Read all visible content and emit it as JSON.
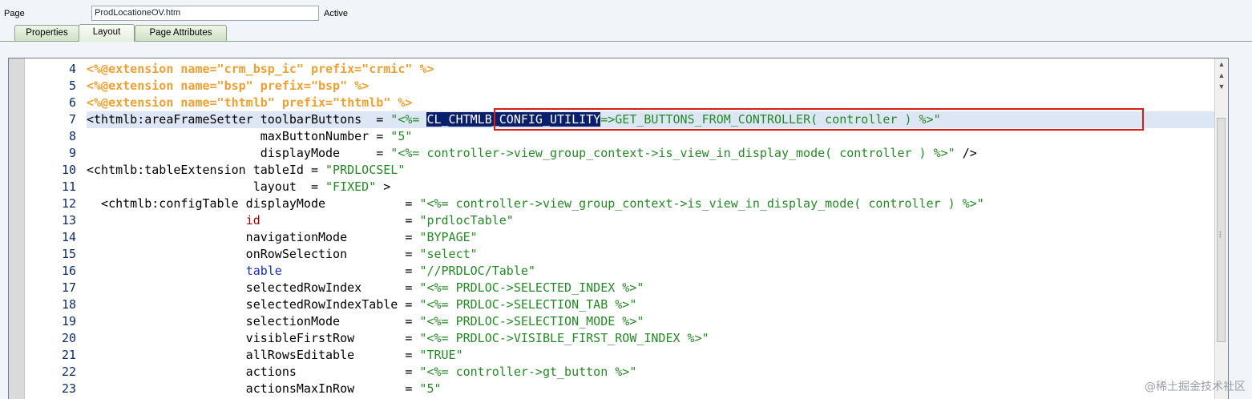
{
  "header": {
    "page_label": "Page",
    "page_value": "ProdLocationeOV.htm",
    "status": "Active"
  },
  "tabs": [
    {
      "label": "Properties",
      "active": false
    },
    {
      "label": "Layout",
      "active": true
    },
    {
      "label": "Page Attributes",
      "active": false
    }
  ],
  "editor": {
    "line_numbers": [
      "4",
      "5",
      "6",
      "7",
      "8",
      "9",
      "10",
      "11",
      "12",
      "13",
      "14",
      "15",
      "16",
      "17",
      "18",
      "19",
      "20",
      "21",
      "22",
      "23"
    ],
    "lines": {
      "l4": [
        "<%@extension name=\"crm_bsp_ic\" prefix=\"crmic\" %>"
      ],
      "l5": [
        "<%@extension name=\"bsp\" prefix=\"bsp\" %>"
      ],
      "l6": [
        "<%@extension name=\"thtmlb\" prefix=\"thtmlb\" %>"
      ],
      "l7": [
        "<thtmlb:areaFrameSetter toolbarButtons  = ",
        "\"<%= ",
        "CL_CHTMLB_CONFIG_UTILITY",
        "=>GET_BUTTONS_FROM_CONTROLLER( controller ) %>\""
      ],
      "l8": [
        "                        maxButtonNumber = ",
        "\"5\""
      ],
      "l9": [
        "                        displayMode     = ",
        "\"<%= controller->view_group_context->is_view_in_display_mode( controller ) %>\"",
        " />"
      ],
      "l10": [
        "<chtmlb:tableExtension tableId = ",
        "\"PRDLOCSEL\""
      ],
      "l11": [
        "                       layout  = ",
        "\"FIXED\"",
        " >"
      ],
      "l12": [
        "  <chtmlb:configTable displayMode           = ",
        "\"<%= controller->view_group_context->is_view_in_display_mode( controller ) %>\""
      ],
      "l13": [
        "                      ",
        "id",
        "                    = ",
        "\"prdlocTable\""
      ],
      "l14": [
        "                      navigationMode        = ",
        "\"BYPAGE\""
      ],
      "l15": [
        "                      onRowSelection        = ",
        "\"select\""
      ],
      "l16": [
        "                      ",
        "table",
        "                 = ",
        "\"//PRDLOC/Table\""
      ],
      "l17": [
        "                      selectedRowIndex      = ",
        "\"<%= PRDLOC->SELECTED_INDEX %>\""
      ],
      "l18": [
        "                      selectedRowIndexTable = ",
        "\"<%= PRDLOC->SELECTION_TAB %>\""
      ],
      "l19": [
        "                      selectionMode         = ",
        "\"<%= PRDLOC->SELECTION_MODE %>\""
      ],
      "l20": [
        "                      visibleFirstRow       = ",
        "\"<%= PRDLOC->VISIBLE_FIRST_ROW_INDEX %>\""
      ],
      "l21": [
        "                      allRowsEditable       = ",
        "\"TRUE\""
      ],
      "l22": [
        "                      actions               = ",
        "\"<%= controller->gt_button %>\""
      ],
      "l23": [
        "                      actionsMaxInRow       = ",
        "\"5\""
      ]
    }
  },
  "watermark": "@稀土掘金技术社区",
  "colors": {
    "directive": "#f0a030",
    "string": "#238b23",
    "keyword_id": "#a00000",
    "keyword_table": "#1530a8",
    "selection_bg": "#0a1f6b",
    "annotation_box": "#d81d1d",
    "active_line": "#dde6f5"
  }
}
